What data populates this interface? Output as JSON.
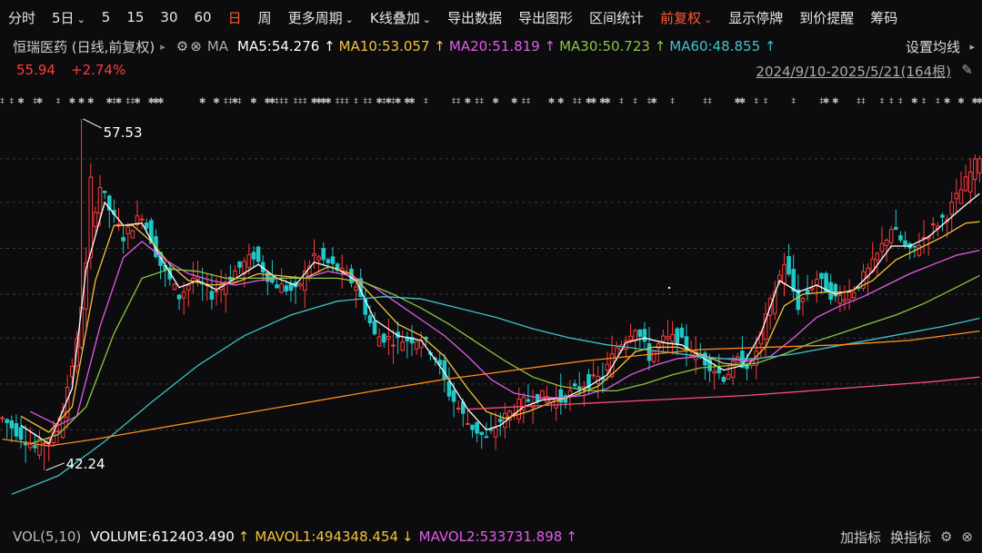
{
  "toolbar": {
    "items": [
      {
        "label": "分时",
        "caret": false,
        "active": false
      },
      {
        "label": "5日",
        "caret": true,
        "active": false
      },
      {
        "label": "5",
        "caret": false,
        "active": false
      },
      {
        "label": "15",
        "caret": false,
        "active": false
      },
      {
        "label": "30",
        "caret": false,
        "active": false
      },
      {
        "label": "60",
        "caret": false,
        "active": false
      },
      {
        "label": "日",
        "caret": false,
        "active": true
      },
      {
        "label": "周",
        "caret": false,
        "active": false
      },
      {
        "label": "更多周期",
        "caret": true,
        "active": false
      },
      {
        "label": "K线叠加",
        "caret": true,
        "active": false
      },
      {
        "label": "导出数据",
        "caret": false,
        "active": false
      },
      {
        "label": "导出图形",
        "caret": false,
        "active": false
      },
      {
        "label": "区间统计",
        "caret": false,
        "active": false
      },
      {
        "label": "前复权",
        "caret": true,
        "active": true
      },
      {
        "label": "显示停牌",
        "caret": false,
        "active": false
      },
      {
        "label": "到价提醒",
        "caret": false,
        "active": false
      },
      {
        "label": "筹码",
        "caret": false,
        "active": false
      }
    ]
  },
  "info": {
    "stock_title": "恒瑞医药 (日线,前复权)",
    "ma_label": "MA",
    "ma": [
      {
        "name": "MA5",
        "value": "54.276",
        "color": "#ffffff"
      },
      {
        "name": "MA10",
        "value": "53.057",
        "color": "#f3c23c"
      },
      {
        "name": "MA20",
        "value": "51.819",
        "color": "#e25ce8"
      },
      {
        "name": "MA30",
        "value": "50.723",
        "color": "#8dc63f"
      },
      {
        "name": "MA60",
        "value": "48.855",
        "color": "#3ec3c9"
      }
    ],
    "settings_label": "设置均线",
    "price": "55.94",
    "change": "+2.74%",
    "date_range": "2024/9/10-2025/5/21(164根)"
  },
  "vol": {
    "label": "VOL(5,10)",
    "volume": "VOLUME:612403.490",
    "mavol1": "MAVOL1:494348.454",
    "mavol2": "MAVOL2:533731.898",
    "add_indicator": "加指标",
    "switch_indicator": "换指标"
  },
  "colors": {
    "up": "#ff3b3b",
    "down": "#1fc8c8",
    "ma_orange": "#ff8c1a",
    "ma_pink": "#ff4e7a"
  },
  "chart_data": {
    "type": "candlestick",
    "x_range": [
      "2024/9/10",
      "2025/5/21"
    ],
    "bar_count": 164,
    "y_range": [
      40.5,
      58.6
    ],
    "annotations": [
      {
        "label": "57.53",
        "value": 57.53,
        "kind": "max"
      },
      {
        "label": "42.24",
        "value": 42.24,
        "kind": "min"
      }
    ],
    "close_keypoints": [
      [
        0,
        44.5
      ],
      [
        7,
        43.2
      ],
      [
        12,
        44.0
      ],
      [
        16,
        47.8
      ],
      [
        19,
        52.8
      ],
      [
        21,
        54.6
      ],
      [
        23,
        53.6
      ],
      [
        26,
        52.4
      ],
      [
        30,
        53.4
      ],
      [
        34,
        51.2
      ],
      [
        38,
        49.8
      ],
      [
        41,
        50.6
      ],
      [
        45,
        49.9
      ],
      [
        50,
        50.9
      ],
      [
        54,
        51.6
      ],
      [
        58,
        50.4
      ],
      [
        63,
        50.0
      ],
      [
        67,
        51.6
      ],
      [
        72,
        51.0
      ],
      [
        76,
        50.3
      ],
      [
        80,
        48.1
      ],
      [
        85,
        47.9
      ],
      [
        90,
        48.0
      ],
      [
        93,
        47.2
      ],
      [
        96,
        45.6
      ],
      [
        100,
        44.3
      ],
      [
        104,
        43.6
      ],
      [
        107,
        44.4
      ],
      [
        111,
        45.1
      ],
      [
        115,
        45.5
      ],
      [
        120,
        45.3
      ],
      [
        125,
        46.0
      ],
      [
        129,
        46.3
      ],
      [
        132,
        47.6
      ],
      [
        136,
        48.5
      ],
      [
        139,
        47.2
      ],
      [
        142,
        47.9
      ],
      [
        145,
        48.0
      ],
      [
        148,
        47.4
      ],
      [
        151,
        47.0
      ],
      [
        155,
        46.3
      ],
      [
        158,
        47.0
      ],
      [
        161,
        46.8
      ],
      [
        165,
        49.5
      ],
      [
        168,
        51.3
      ],
      [
        171,
        49.4
      ],
      [
        175,
        50.6
      ],
      [
        179,
        49.7
      ],
      [
        183,
        50.1
      ],
      [
        187,
        51.2
      ],
      [
        191,
        52.8
      ],
      [
        195,
        51.7
      ],
      [
        199,
        52.6
      ],
      [
        203,
        53.4
      ],
      [
        207,
        54.8
      ],
      [
        210,
        55.94
      ]
    ],
    "ma_keypoints": {
      "MA5": [
        [
          4,
          44.2
        ],
        [
          10,
          43.4
        ],
        [
          15,
          45.8
        ],
        [
          18,
          51.0
        ],
        [
          22,
          53.9
        ],
        [
          26,
          52.9
        ],
        [
          30,
          53.0
        ],
        [
          34,
          51.5
        ],
        [
          38,
          50.2
        ],
        [
          42,
          50.5
        ],
        [
          46,
          50.1
        ],
        [
          51,
          50.7
        ],
        [
          55,
          51.2
        ],
        [
          59,
          50.6
        ],
        [
          63,
          50.3
        ],
        [
          67,
          51.3
        ],
        [
          72,
          51.0
        ],
        [
          76,
          50.5
        ],
        [
          80,
          48.8
        ],
        [
          85,
          48.1
        ],
        [
          90,
          47.9
        ],
        [
          95,
          46.5
        ],
        [
          100,
          44.9
        ],
        [
          104,
          44.0
        ],
        [
          107,
          44.2
        ],
        [
          112,
          45.0
        ],
        [
          116,
          45.3
        ],
        [
          121,
          45.4
        ],
        [
          126,
          45.9
        ],
        [
          130,
          46.4
        ],
        [
          134,
          47.8
        ],
        [
          138,
          48.0
        ],
        [
          142,
          47.8
        ],
        [
          146,
          47.7
        ],
        [
          150,
          47.2
        ],
        [
          155,
          46.6
        ],
        [
          159,
          46.8
        ],
        [
          163,
          48.2
        ],
        [
          167,
          50.5
        ],
        [
          171,
          50.0
        ],
        [
          175,
          50.3
        ],
        [
          179,
          49.9
        ],
        [
          183,
          50.1
        ],
        [
          187,
          50.9
        ],
        [
          191,
          52.0
        ],
        [
          195,
          52.0
        ],
        [
          199,
          52.4
        ],
        [
          203,
          53.1
        ],
        [
          207,
          53.8
        ],
        [
          210,
          54.28
        ]
      ],
      "MA10": [
        [
          4,
          44.6
        ],
        [
          10,
          43.9
        ],
        [
          15,
          45.0
        ],
        [
          20,
          50.5
        ],
        [
          24,
          52.9
        ],
        [
          28,
          52.9
        ],
        [
          32,
          52.2
        ],
        [
          36,
          51.2
        ],
        [
          40,
          50.5
        ],
        [
          45,
          50.3
        ],
        [
          50,
          50.4
        ],
        [
          55,
          50.8
        ],
        [
          60,
          50.7
        ],
        [
          65,
          50.6
        ],
        [
          70,
          51.1
        ],
        [
          75,
          50.8
        ],
        [
          80,
          49.7
        ],
        [
          85,
          48.6
        ],
        [
          90,
          48.1
        ],
        [
          95,
          47.2
        ],
        [
          100,
          45.8
        ],
        [
          104,
          44.8
        ],
        [
          108,
          44.5
        ],
        [
          113,
          44.8
        ],
        [
          118,
          45.2
        ],
        [
          123,
          45.5
        ],
        [
          128,
          45.9
        ],
        [
          132,
          46.6
        ],
        [
          136,
          47.4
        ],
        [
          140,
          47.6
        ],
        [
          145,
          47.6
        ],
        [
          150,
          47.3
        ],
        [
          155,
          46.9
        ],
        [
          160,
          46.8
        ],
        [
          164,
          47.6
        ],
        [
          168,
          49.4
        ],
        [
          172,
          49.9
        ],
        [
          177,
          50.0
        ],
        [
          182,
          50.0
        ],
        [
          187,
          50.5
        ],
        [
          192,
          51.4
        ],
        [
          197,
          51.9
        ],
        [
          202,
          52.4
        ],
        [
          207,
          53.0
        ],
        [
          210,
          53.06
        ]
      ],
      "MA20": [
        [
          6,
          44.8
        ],
        [
          12,
          44.2
        ],
        [
          16,
          44.6
        ],
        [
          21,
          48.5
        ],
        [
          26,
          51.5
        ],
        [
          30,
          52.2
        ],
        [
          35,
          51.4
        ],
        [
          40,
          50.8
        ],
        [
          45,
          50.5
        ],
        [
          50,
          50.3
        ],
        [
          55,
          50.5
        ],
        [
          60,
          50.6
        ],
        [
          65,
          50.6
        ],
        [
          70,
          50.9
        ],
        [
          75,
          50.7
        ],
        [
          80,
          50.2
        ],
        [
          85,
          49.5
        ],
        [
          90,
          48.8
        ],
        [
          95,
          48.1
        ],
        [
          100,
          47.2
        ],
        [
          105,
          46.2
        ],
        [
          110,
          45.6
        ],
        [
          115,
          45.4
        ],
        [
          120,
          45.4
        ],
        [
          125,
          45.5
        ],
        [
          130,
          45.8
        ],
        [
          135,
          46.4
        ],
        [
          140,
          46.8
        ],
        [
          145,
          47.1
        ],
        [
          150,
          47.2
        ],
        [
          155,
          47.1
        ],
        [
          160,
          47.0
        ],
        [
          165,
          47.2
        ],
        [
          170,
          48.0
        ],
        [
          175,
          48.9
        ],
        [
          180,
          49.4
        ],
        [
          185,
          49.8
        ],
        [
          190,
          50.3
        ],
        [
          195,
          50.8
        ],
        [
          200,
          51.2
        ],
        [
          205,
          51.6
        ],
        [
          210,
          51.82
        ]
      ],
      "MA30": [
        [
          6,
          43.4
        ],
        [
          12,
          43.8
        ],
        [
          18,
          45.0
        ],
        [
          24,
          48.2
        ],
        [
          30,
          50.6
        ],
        [
          36,
          51.0
        ],
        [
          42,
          50.9
        ],
        [
          48,
          50.6
        ],
        [
          54,
          50.6
        ],
        [
          60,
          50.6
        ],
        [
          66,
          50.6
        ],
        [
          72,
          50.6
        ],
        [
          78,
          50.4
        ],
        [
          84,
          49.9
        ],
        [
          90,
          49.3
        ],
        [
          96,
          48.6
        ],
        [
          102,
          47.8
        ],
        [
          108,
          47.0
        ],
        [
          114,
          46.3
        ],
        [
          120,
          45.9
        ],
        [
          126,
          45.7
        ],
        [
          132,
          45.7
        ],
        [
          138,
          46.0
        ],
        [
          144,
          46.4
        ],
        [
          150,
          46.7
        ],
        [
          156,
          46.8
        ],
        [
          162,
          46.9
        ],
        [
          168,
          47.3
        ],
        [
          174,
          47.8
        ],
        [
          180,
          48.2
        ],
        [
          186,
          48.6
        ],
        [
          192,
          49.0
        ],
        [
          198,
          49.5
        ],
        [
          204,
          50.1
        ],
        [
          210,
          50.72
        ]
      ],
      "MA60": [
        [
          2,
          41.2
        ],
        [
          12,
          42.0
        ],
        [
          22,
          43.5
        ],
        [
          32,
          45.2
        ],
        [
          42,
          46.8
        ],
        [
          52,
          48.1
        ],
        [
          62,
          49.0
        ],
        [
          72,
          49.6
        ],
        [
          82,
          49.8
        ],
        [
          90,
          49.7
        ],
        [
          98,
          49.3
        ],
        [
          106,
          48.9
        ],
        [
          114,
          48.4
        ],
        [
          122,
          48.0
        ],
        [
          130,
          47.7
        ],
        [
          138,
          47.5
        ],
        [
          146,
          47.3
        ],
        [
          154,
          47.1
        ],
        [
          162,
          47.1
        ],
        [
          170,
          47.3
        ],
        [
          178,
          47.6
        ],
        [
          186,
          47.9
        ],
        [
          194,
          48.2
        ],
        [
          202,
          48.5
        ],
        [
          210,
          48.86
        ]
      ],
      "MA_ORANGE": [
        [
          0,
          43.6
        ],
        [
          10,
          43.3
        ],
        [
          20,
          43.6
        ],
        [
          40,
          44.3
        ],
        [
          60,
          45.0
        ],
        [
          80,
          45.7
        ],
        [
          95,
          46.2
        ],
        [
          110,
          46.6
        ],
        [
          125,
          47.0
        ],
        [
          140,
          47.3
        ],
        [
          150,
          47.5
        ],
        [
          165,
          47.6
        ],
        [
          180,
          47.7
        ],
        [
          195,
          47.9
        ],
        [
          210,
          48.3
        ]
      ],
      "MA_PINK": [
        [
          100,
          44.9
        ],
        [
          120,
          45.1
        ],
        [
          140,
          45.3
        ],
        [
          160,
          45.5
        ],
        [
          180,
          45.8
        ],
        [
          200,
          46.1
        ],
        [
          210,
          46.3
        ]
      ]
    }
  }
}
